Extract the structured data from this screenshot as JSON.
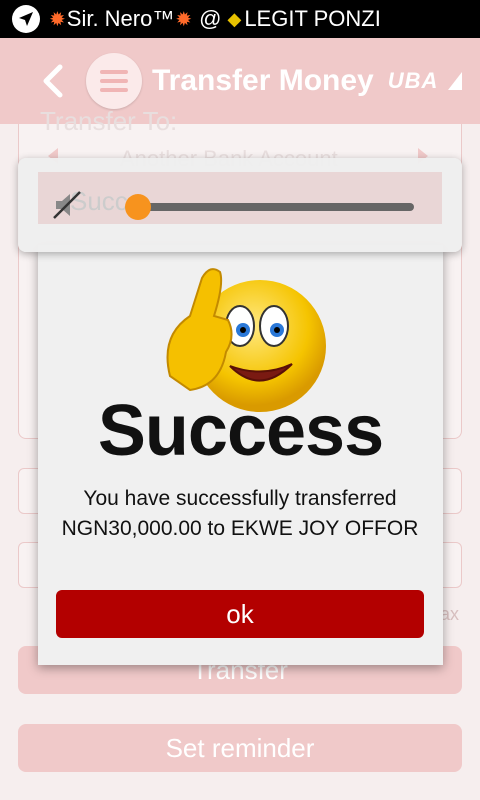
{
  "status_bar": {
    "text": "Sir. Nero™",
    "separator": "@",
    "channel": "LEGIT PONZI"
  },
  "header": {
    "title": "Transfer Money",
    "brand": "UBA"
  },
  "background_form": {
    "section_label": "Transfer To:",
    "account_type": "Another Bank Account",
    "hint": "ax",
    "transfer_button": "Transfer",
    "reminder_button": "Set reminder"
  },
  "volume": {
    "level": 0.0,
    "overlay_text": "Succe"
  },
  "dialog": {
    "title": "Success",
    "message": "You have successfully transferred NGN30,000.00 to EKWE JOY OFFOR",
    "ok_label": "ok"
  },
  "colors": {
    "accent": "#b30000",
    "header": "#f0c9c9",
    "thumb": "#f7931e"
  }
}
